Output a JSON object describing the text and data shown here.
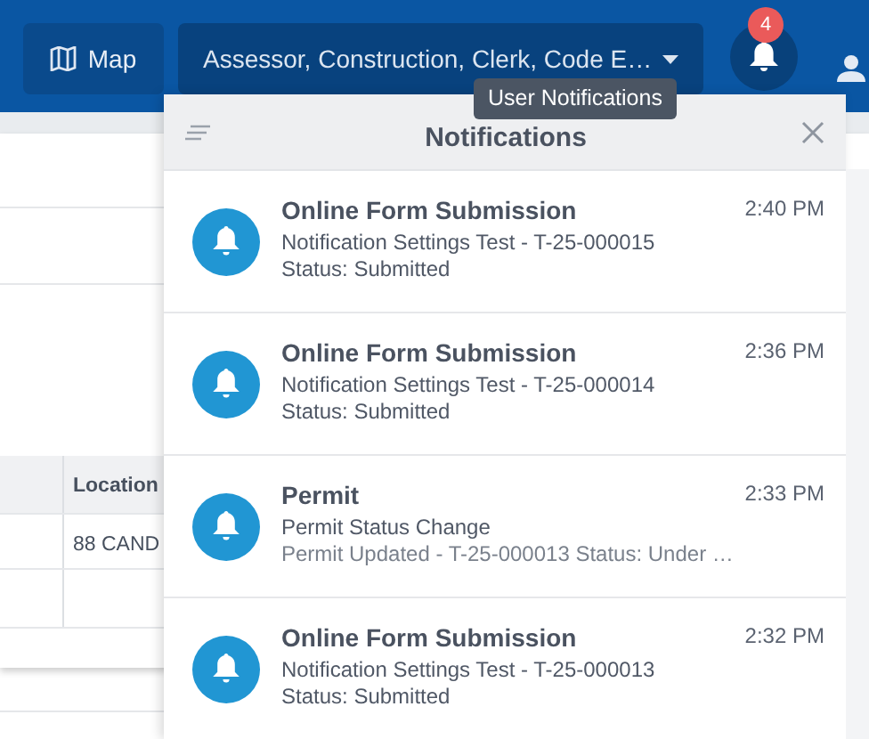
{
  "navbar": {
    "map_button": "Map",
    "department_select": "Assessor, Construction, Clerk, Code E…",
    "notification_count": "4",
    "tooltip": "User Notifications"
  },
  "background_table": {
    "columns": [
      "Location"
    ],
    "rows": [
      [
        "88 CAND"
      ]
    ]
  },
  "notifications": {
    "title": "Notifications",
    "items": [
      {
        "title": "Online Form Submission",
        "message": "Notification Settings Test - T-25-000015 Status: Submitted",
        "time": "2:40 PM"
      },
      {
        "title": "Online Form Submission",
        "message": "Notification Settings Test - T-25-000014 Status: Submitted",
        "time": "2:36 PM"
      },
      {
        "title": "Permit",
        "message": "Permit Status Change",
        "detail": "Permit Updated - T-25-000013 Status: Under …",
        "time": "2:33 PM"
      },
      {
        "title": "Online Form Submission",
        "message": "Notification Settings Test - T-25-000013 Status: Submitted",
        "time": "2:32 PM"
      }
    ]
  }
}
